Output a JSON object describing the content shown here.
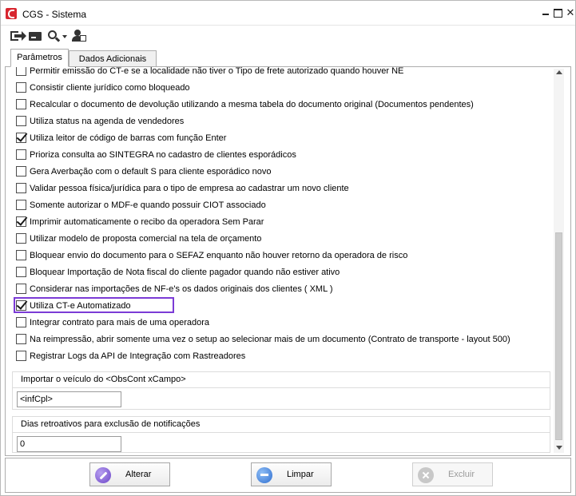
{
  "window": {
    "title": "CGS - Sistema"
  },
  "tabs": [
    {
      "label": "Parâmetros",
      "active": true
    },
    {
      "label": "Dados Adicionais",
      "active": false
    }
  ],
  "options": [
    {
      "label": "Permitir emissão do CT-e se a localidade não tiver o Tipo de frete autorizado quando houver NE",
      "checked": false
    },
    {
      "label": "Consistir cliente jurídico como bloqueado",
      "checked": false
    },
    {
      "label": "Recalcular o documento de devolução utilizando a mesma tabela do documento original (Documentos pendentes)",
      "checked": false
    },
    {
      "label": "Utiliza status na agenda de vendedores",
      "checked": false
    },
    {
      "label": "Utiliza leitor de código de barras com função Enter",
      "checked": true
    },
    {
      "label": "Prioriza consulta ao SINTEGRA no cadastro de clientes esporádicos",
      "checked": false
    },
    {
      "label": "Gera Averbação com o default S para cliente esporádico novo",
      "checked": false
    },
    {
      "label": "Validar pessoa física/jurídica para o tipo de empresa ao cadastrar um novo cliente",
      "checked": false
    },
    {
      "label": "Somente autorizar o MDF-e quando possuir CIOT associado",
      "checked": false
    },
    {
      "label": "Imprimir automaticamente o recibo da operadora Sem Parar",
      "checked": true
    },
    {
      "label": "Utilizar modelo de proposta comercial na tela de orçamento",
      "checked": false
    },
    {
      "label": "Bloquear envio do documento para o SEFAZ  enquanto não houver retorno da operadora de risco",
      "checked": false
    },
    {
      "label": "Bloquear Importação de Nota fiscal do cliente pagador quando não estiver ativo",
      "checked": false
    },
    {
      "label": "Considerar nas importações de NF-e's os dados originais dos clientes ( XML )",
      "checked": false
    },
    {
      "label": "Utiliza CT-e Automatizado",
      "checked": true
    },
    {
      "label": "Integrar contrato para mais de uma operadora",
      "checked": false
    },
    {
      "label": "Na reimpressão, abrir somente uma vez o setup ao selecionar mais de um documento (Contrato de transporte - layout 500)",
      "checked": false
    },
    {
      "label": "Registrar Logs da API de Integração com Rastreadores",
      "checked": false
    }
  ],
  "veiculo_group": {
    "title": "Importar o veículo do <ObsCont xCampo>",
    "value": "<infCpl>"
  },
  "dias_group": {
    "title": "Dias retroativos para exclusão de notificações",
    "value": "0"
  },
  "buttons": {
    "alterar": "Alterar",
    "limpar": "Limpar",
    "excluir": "Excluir"
  },
  "colors": {
    "highlight": "#7b3bd6",
    "app_icon": "#d8262f"
  }
}
